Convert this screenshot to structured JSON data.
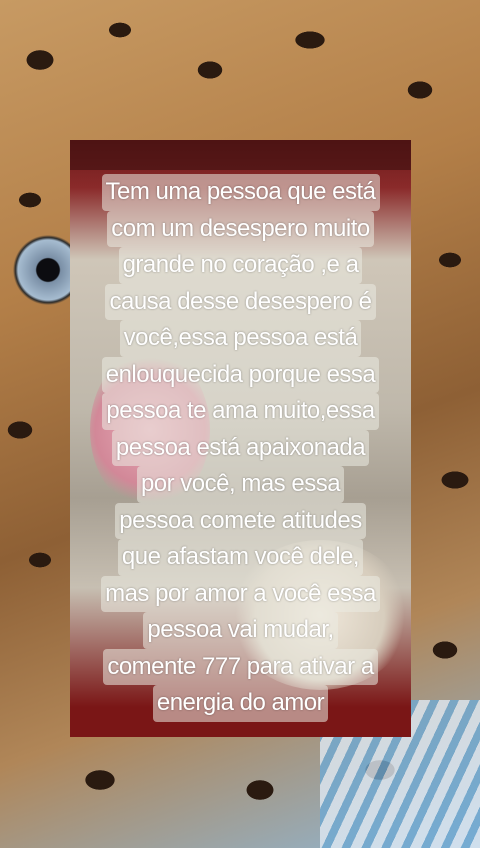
{
  "caption": {
    "lines": [
      "Tem uma pessoa que está",
      "com um desespero muito",
      "grande no coração ,e a",
      "causa desse desespero é",
      "você,essa pessoa está",
      "enlouquecida porque essa",
      "pessoa te ama muito,essa",
      "pessoa está apaixonada",
      "por você, mas essa",
      "pessoa comete atitudes",
      "que afastam você dele,",
      "mas por amor a você essa",
      "pessoa vai mudar,",
      "comente 777 para ativar a",
      "energia do amor"
    ]
  }
}
